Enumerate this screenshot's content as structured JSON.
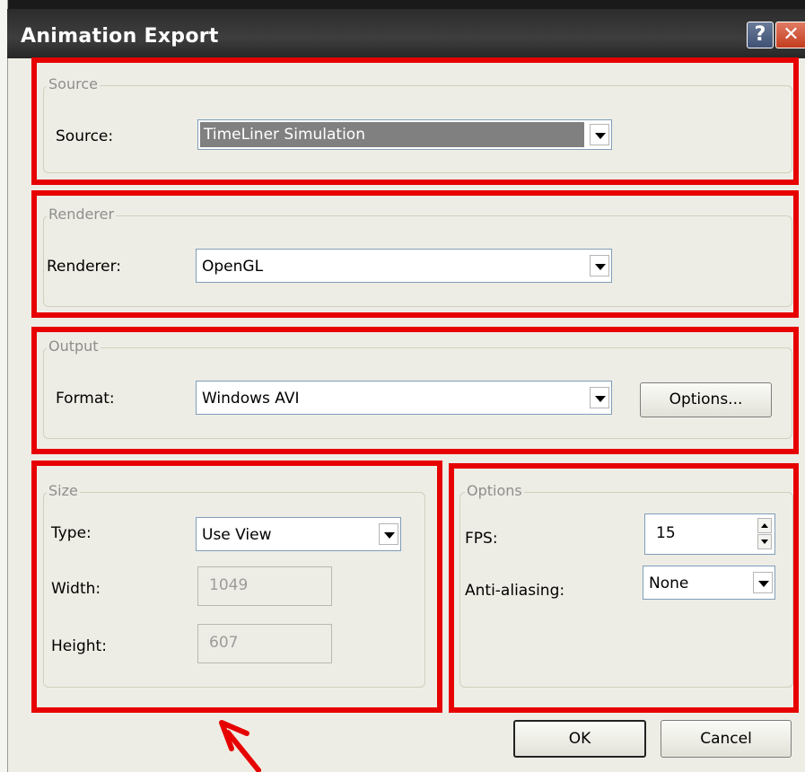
{
  "window": {
    "title": "Animation Export",
    "help_glyph": "?",
    "close_glyph": "✕"
  },
  "source": {
    "group_label": "Source",
    "field_label": "Source:",
    "value": "TimeLiner Simulation"
  },
  "renderer": {
    "group_label": "Renderer",
    "field_label": "Renderer:",
    "value": "OpenGL"
  },
  "output": {
    "group_label": "Output",
    "field_label": "Format:",
    "value": "Windows AVI",
    "options_button": "Options..."
  },
  "size": {
    "group_label": "Size",
    "type_label": "Type:",
    "type_value": "Use View",
    "width_label": "Width:",
    "width_value": "1049",
    "height_label": "Height:",
    "height_value": "607"
  },
  "options": {
    "group_label": "Options",
    "fps_label": "FPS:",
    "fps_value": "15",
    "aa_label": "Anti-aliasing:",
    "aa_value": "None"
  },
  "buttons": {
    "ok": "OK",
    "cancel": "Cancel"
  },
  "icons": {
    "dropdown": "chevron-down-icon",
    "help": "help-icon",
    "close": "close-icon",
    "spin_up": "spin-up-icon",
    "spin_down": "spin-down-icon",
    "annotation_arrow": "arrow-icon"
  },
  "colors": {
    "annotation": "#e60000",
    "dialog_bg": "#eeede5",
    "titlebar": "#2c2c2c"
  }
}
